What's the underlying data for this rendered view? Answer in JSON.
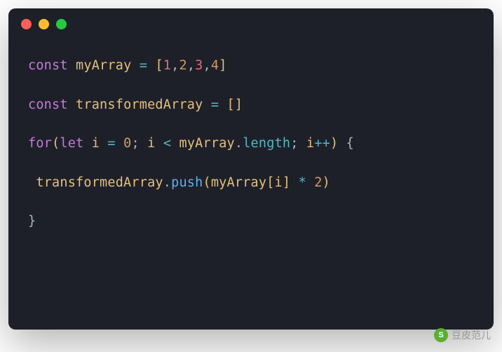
{
  "code": {
    "line1": {
      "kw": "const",
      "var": "myArray",
      "op_eq": "=",
      "br_open": "[",
      "n1": "1",
      "c1": ",",
      "n2": "2",
      "c2": ",",
      "n3": "3",
      "c3": ",",
      "n4": "4",
      "br_close": "]"
    },
    "line2": {
      "kw": "const",
      "var": "transformedArray",
      "op_eq": "=",
      "br_open": "[",
      "br_close": "]"
    },
    "line3": {
      "kw_for": "for",
      "p_open": "(",
      "kw_let": "let",
      "var_i": "i",
      "op_eq": "=",
      "zero": "0",
      "semi1": ";",
      "var_i2": "i",
      "op_lt": "<",
      "var_arr": "myArray",
      "dot1": ".",
      "prop_len": "length",
      "semi2": ";",
      "var_i3": "i",
      "op_inc": "++",
      "p_close": ")",
      "brace_open": "{"
    },
    "line4": {
      "var_t": "transformedArray",
      "dot1": ".",
      "fn_push": "push",
      "p_open": "(",
      "var_arr": "myArray",
      "br_open": "[",
      "var_i": "i",
      "br_close": "]",
      "op_mul": "*",
      "two": "2",
      "p_close": ")"
    },
    "line5": {
      "brace_close": "}"
    }
  },
  "watermark": {
    "icon": "S",
    "text": "豆皮范儿"
  }
}
